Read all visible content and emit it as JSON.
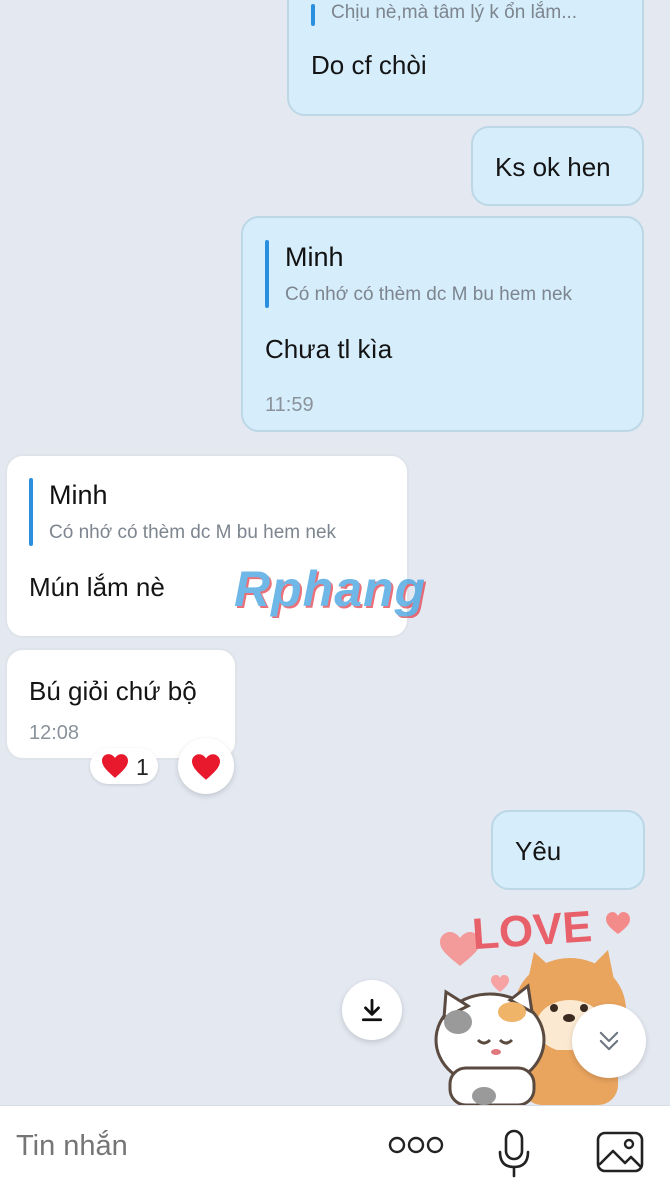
{
  "messages": {
    "m1": {
      "quote_snippet": "Chịu nè,mà tâm lý k ổn lắm...",
      "text": "Do cf chòi"
    },
    "m2": {
      "text": "Ks ok hen"
    },
    "m3": {
      "quote_name": "Minh",
      "quote_snippet": "Có nhớ có thèm dc M bu hem nek",
      "text": "Chưa tl kìa",
      "time": "11:59"
    },
    "m4": {
      "quote_name": "Minh",
      "quote_snippet": "Có nhớ có thèm dc M bu hem nek",
      "text": "Mún lắm nè"
    },
    "m5": {
      "text": "Bú giỏi chứ bộ",
      "time": "12:08",
      "reaction_count": "1"
    },
    "m6": {
      "text": "Yêu"
    }
  },
  "sticker": {
    "text": "LOVE"
  },
  "watermark": "Rphang",
  "input": {
    "placeholder": "Tin nhắn"
  },
  "icons": {
    "reaction": "heart-icon",
    "download": "download-icon",
    "scroll_down": "double-chevron-down-icon",
    "more": "more-icon",
    "mic": "microphone-icon",
    "image": "image-icon"
  },
  "colors": {
    "background": "#e3e8f1",
    "outgoing_bubble": "#d6edfb",
    "incoming_bubble": "#ffffff",
    "quote_bar": "#2b8fe0",
    "heart": "#e8192c"
  }
}
